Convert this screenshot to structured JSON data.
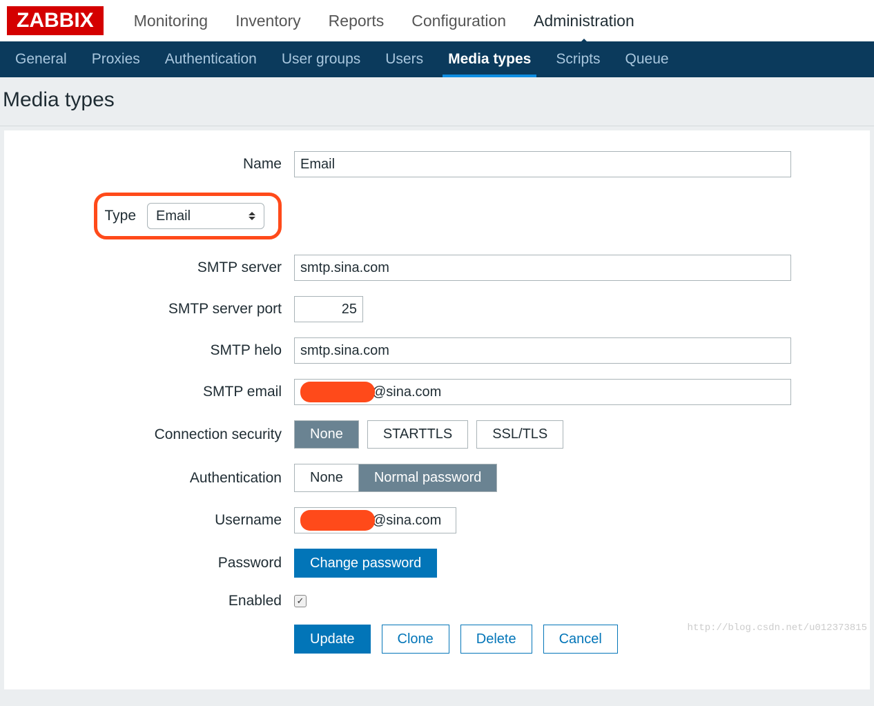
{
  "logo": "ZABBIX",
  "topnav": {
    "items": [
      "Monitoring",
      "Inventory",
      "Reports",
      "Configuration",
      "Administration"
    ],
    "activeIndex": 4
  },
  "subnav": {
    "items": [
      "General",
      "Proxies",
      "Authentication",
      "User groups",
      "Users",
      "Media types",
      "Scripts",
      "Queue"
    ],
    "activeIndex": 5
  },
  "pageTitle": "Media types",
  "form": {
    "name": {
      "label": "Name",
      "value": "Email"
    },
    "type": {
      "label": "Type",
      "value": "Email"
    },
    "smtp_server": {
      "label": "SMTP server",
      "value": "smtp.sina.com"
    },
    "smtp_port": {
      "label": "SMTP server port",
      "value": "25"
    },
    "smtp_helo": {
      "label": "SMTP helo",
      "value": "smtp.sina.com"
    },
    "smtp_email": {
      "label": "SMTP email",
      "suffix": "@sina.com"
    },
    "conn_security": {
      "label": "Connection security",
      "options": [
        "None",
        "STARTTLS",
        "SSL/TLS"
      ],
      "selected": 0
    },
    "authentication": {
      "label": "Authentication",
      "options": [
        "None",
        "Normal password"
      ],
      "selected": 1
    },
    "username": {
      "label": "Username",
      "suffix": "@sina.com"
    },
    "password": {
      "label": "Password",
      "button": "Change password"
    },
    "enabled": {
      "label": "Enabled",
      "checked": true
    }
  },
  "actions": {
    "update": "Update",
    "clone": "Clone",
    "delete": "Delete",
    "cancel": "Cancel"
  },
  "watermark": "http://blog.csdn.net/u012373815"
}
